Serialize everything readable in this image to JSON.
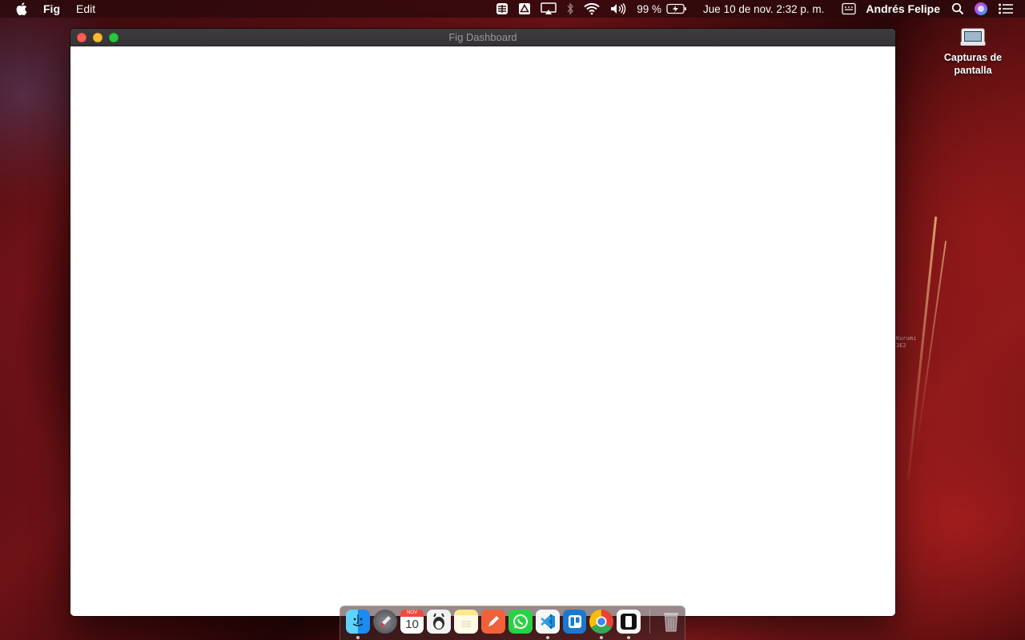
{
  "menubar": {
    "apple_icon": "apple-logo-icon",
    "app_name": "Fig",
    "menu_items": [
      "Edit"
    ],
    "battery_percent": "99 %",
    "datetime": "Jue 10 de nov.  2:32 p. m.",
    "user_name": "Andrés Felipe",
    "status_icons": [
      "vpn-icon",
      "drive-icon",
      "airplay-icon",
      "bluetooth-icon",
      "wifi-icon",
      "volume-icon",
      "battery-charging-icon",
      "keyboard-input-icon",
      "spotlight-search-icon",
      "siri-icon",
      "notification-center-icon"
    ]
  },
  "window": {
    "title": "Fig Dashboard",
    "controls": [
      "close",
      "minimize",
      "zoom"
    ]
  },
  "desktop": {
    "icon_label": "Capturas de pantalla",
    "icon_name": "folder-icon",
    "wallpaper_caption": [
      "Kurumi",
      "3E2"
    ]
  },
  "dock": {
    "items": [
      {
        "name": "finder",
        "running": true
      },
      {
        "name": "launchpad",
        "running": false
      },
      {
        "name": "calendar",
        "running": false,
        "month": "NOV",
        "day": "10"
      },
      {
        "name": "vlc",
        "running": false
      },
      {
        "name": "notes",
        "running": false
      },
      {
        "name": "pencil-app",
        "running": false
      },
      {
        "name": "whatsapp",
        "running": false
      },
      {
        "name": "vscode",
        "running": true
      },
      {
        "name": "trello",
        "running": false
      },
      {
        "name": "chrome",
        "running": true
      },
      {
        "name": "fig",
        "running": true
      },
      {
        "name": "trash",
        "running": false
      }
    ]
  },
  "colors": {
    "close": "#ff5f57",
    "minimize": "#febc2e",
    "zoom": "#28c840",
    "titlebar": "#3a383a",
    "window_content": "#ffffff"
  }
}
